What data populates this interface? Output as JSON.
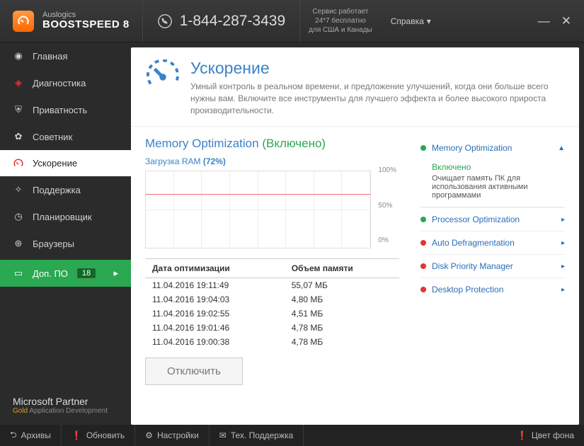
{
  "titlebar": {
    "brand1": "Auslogics",
    "brand2": "BOOSTSPEED 8",
    "phone": "1-844-287-3439",
    "service1": "Сервис работает",
    "service2": "24*7 бесплатно",
    "service3": "для США и Канады",
    "help": "Справка"
  },
  "sidebar": {
    "items": [
      {
        "label": "Главная"
      },
      {
        "label": "Диагностика"
      },
      {
        "label": "Приватность"
      },
      {
        "label": "Советник"
      },
      {
        "label": "Ускорение"
      },
      {
        "label": "Поддержка"
      },
      {
        "label": "Планировщик"
      },
      {
        "label": "Браузеры"
      }
    ],
    "extra": {
      "label": "Доп. ПО",
      "badge": "18"
    },
    "partner1": "Microsoft Partner",
    "partner2a": "Gold",
    "partner2b": " Application Development"
  },
  "page": {
    "title": "Ускорение",
    "desc": "Умный контроль в реальном времени, и предложение улучшений, когда они больше всего нужны вам. Включите все инструменты для лучшего эффекта и более высокого прироста производительности."
  },
  "memory": {
    "title": "Memory Optimization ",
    "enabled": "(Включено)",
    "ram_prefix": "Загрузка RAM ",
    "ram_pct": "(72%)",
    "ticks": [
      "100%",
      "50%",
      "0%"
    ],
    "th1": "Дата оптимизации",
    "th2": "Объем памяти",
    "rows": [
      {
        "date": "11.04.2016 19:11:49",
        "size": "55,07 МБ"
      },
      {
        "date": "11.04.2016 19:04:03",
        "size": "4,80 МБ"
      },
      {
        "date": "11.04.2016 19:02:55",
        "size": "4,51 МБ"
      },
      {
        "date": "11.04.2016 19:01:46",
        "size": "4,78 МБ"
      },
      {
        "date": "11.04.2016 19:00:38",
        "size": "4,78 МБ"
      }
    ],
    "btn": "Отключить"
  },
  "tools": [
    {
      "name": "Memory Optimization",
      "color": "g"
    },
    {
      "name": "Processor Optimization",
      "color": "g"
    },
    {
      "name": "Auto Defragmentation",
      "color": "r"
    },
    {
      "name": "Disk Priority Manager",
      "color": "r"
    },
    {
      "name": "Desktop Protection",
      "color": "r"
    }
  ],
  "tool_detail": {
    "on": "Включено",
    "desc": "Очищает память ПК для использования активными программами"
  },
  "footer": {
    "archive": "Архивы",
    "update": "Обновить",
    "settings": "Настройки",
    "support": "Тех. Поддержка",
    "theme": "Цвет фона"
  }
}
